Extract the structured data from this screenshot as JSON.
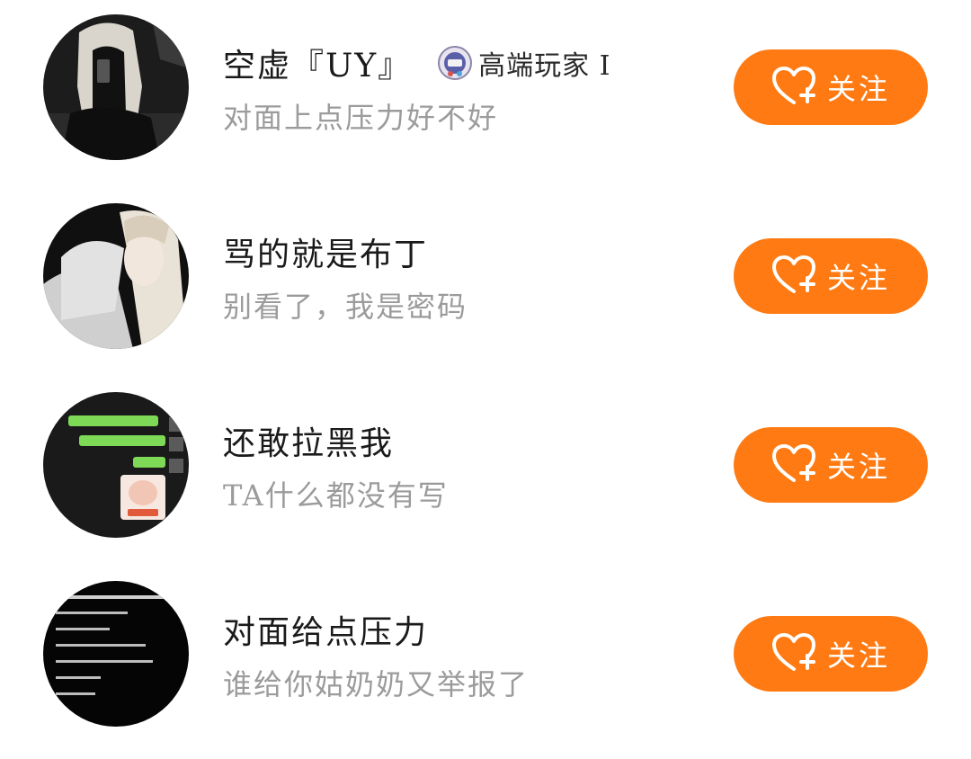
{
  "follow_list": {
    "accent_color": "#ff7a12",
    "items": [
      {
        "name": "空虚『UY』",
        "badge_icon": "game-rank-badge-icon",
        "badge_text": "高端玩家 I",
        "signature": "对面上点压力好不好",
        "follow_label": "关注",
        "follow_icon": "heart-plus-icon",
        "avatar": "avatar-girl-phone-selfie"
      },
      {
        "name": "骂的就是布丁",
        "signature": "别看了，我是密码",
        "follow_label": "关注",
        "follow_icon": "heart-plus-icon",
        "avatar": "avatar-girl-sweater"
      },
      {
        "name": "还敢拉黑我",
        "signature": "TA什么都没有写",
        "follow_label": "关注",
        "follow_icon": "heart-plus-icon",
        "avatar": "avatar-chat-screenshot"
      },
      {
        "name": "对面给点压力",
        "signature": "谁给你姑奶奶又举报了",
        "follow_label": "关注",
        "follow_icon": "heart-plus-icon",
        "avatar": "avatar-dark-text"
      }
    ]
  }
}
